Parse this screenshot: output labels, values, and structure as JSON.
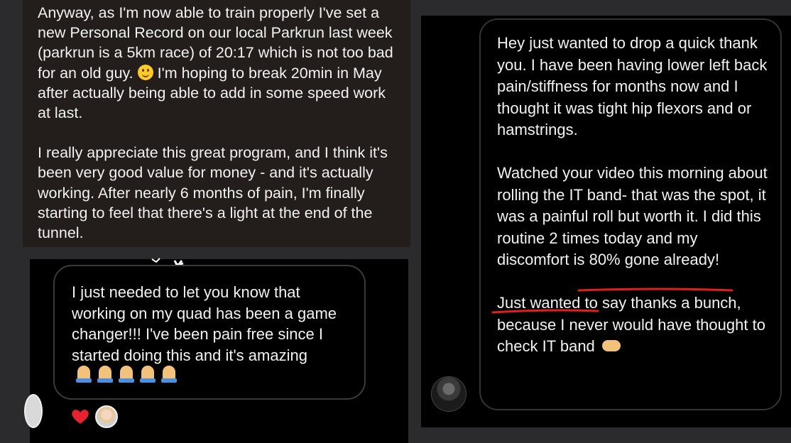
{
  "top_left": {
    "paragraph1": "Anyway, as I'm now able to train properly I've set a new Personal Record on our local Parkrun last week (parkrun is a 5km race) of 20:17 which is not too bad for an old guy.",
    "paragraph1_after_emoji": " I'm hoping to break 20min in May after actually being able to add in some speed work at last.",
    "paragraph2": "I really appreciate this great program, and I think it's been very good value for money - and it's actually working. After nearly 6 months of pain, I'm finally starting to feel that there's a light at the end of the tunnel."
  },
  "bottom_left": {
    "message": "I just needed to let you know that working on my quad has been a game changer!!! I've been pain free since I started doing this and it's amazing"
  },
  "right": {
    "paragraph1": "Hey just wanted to drop a quick thank you. I have been having lower left back pain/stiffness for months now and I thought it was tight hip flexors and or hamstrings.",
    "paragraph2_start": "Watched your video this morning about rolling the IT band- that was the spot, it was a painful roll but worth it. I did this routine 2 times today and ",
    "paragraph2_highlight": "my discomfort is 80% gone already",
    "paragraph2_end": "!",
    "paragraph3": "Just wanted to say thanks a bunch, because I never would have thought to check IT band"
  },
  "colors": {
    "underline": "#e02020",
    "heart": "#e8232f"
  }
}
